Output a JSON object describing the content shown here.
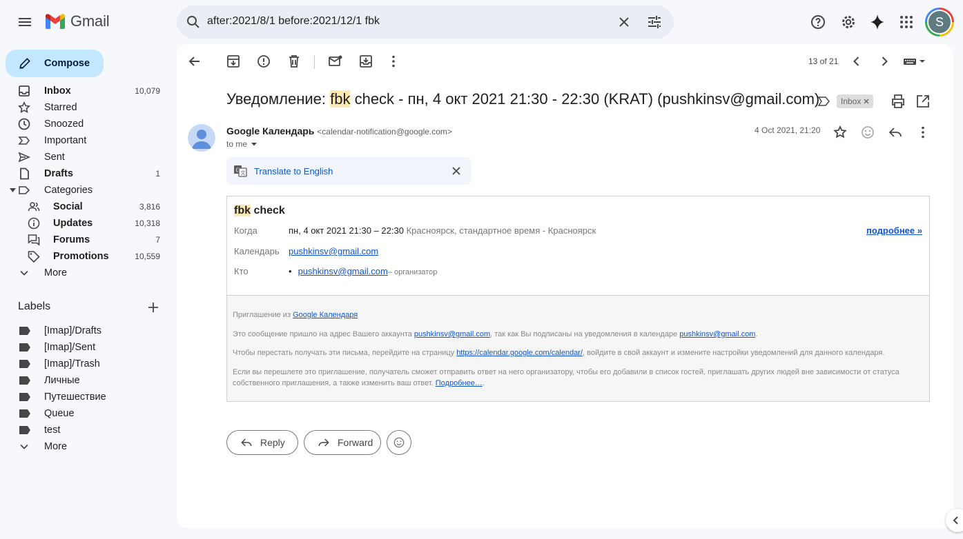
{
  "app": {
    "name": "Gmail"
  },
  "search": {
    "query": "after:2021/8/1 before:2021/12/1 fbk"
  },
  "compose": {
    "label": "Compose"
  },
  "nav": [
    {
      "label": "Inbox",
      "count": "10,079",
      "icon": "inbox-icon",
      "bold": true
    },
    {
      "label": "Starred",
      "count": "",
      "icon": "star-icon",
      "bold": false
    },
    {
      "label": "Snoozed",
      "count": "",
      "icon": "clock-icon",
      "bold": false
    },
    {
      "label": "Important",
      "count": "",
      "icon": "important-icon",
      "bold": false
    },
    {
      "label": "Sent",
      "count": "",
      "icon": "send-icon",
      "bold": false
    },
    {
      "label": "Drafts",
      "count": "1",
      "icon": "draft-icon",
      "bold": true
    },
    {
      "label": "Categories",
      "count": "",
      "icon": "label-icon",
      "bold": false
    }
  ],
  "categories": [
    {
      "label": "Social",
      "count": "3,816",
      "icon": "people-icon"
    },
    {
      "label": "Updates",
      "count": "10,318",
      "icon": "info-icon"
    },
    {
      "label": "Forums",
      "count": "7",
      "icon": "forum-icon"
    },
    {
      "label": "Promotions",
      "count": "10,559",
      "icon": "tag-icon"
    }
  ],
  "nav_more": "More",
  "labels": {
    "title": "Labels",
    "items": [
      "[Imap]/Drafts",
      "[Imap]/Sent",
      "[Imap]/Trash",
      "Личные",
      "Путешествие",
      "Queue",
      "test"
    ],
    "more": "More"
  },
  "toolbar": {
    "pager": "13 of 21"
  },
  "email": {
    "subject_prefix": "Уведомление: ",
    "subject_highlight": "fbk",
    "subject_rest": " check - пн, 4 окт 2021 21:30 - 22:30 (KRAT) (pushkinsv@gmail.com)",
    "inbox_chip": "Inbox",
    "sender_name": "Google Календарь",
    "sender_email": "<calendar-notification@google.com>",
    "to": "to me",
    "date": "4 Oct 2021, 21:20",
    "translate": "Translate to English"
  },
  "invite": {
    "title_highlight": "fbk",
    "title_rest": " check",
    "when_label": "Когда",
    "when_time": "пн, 4 окт 2021 21:30 – 22:30",
    "when_tz": " Красноярск, стандартное время - Красноярск",
    "more_details": "подробнее »",
    "calendar_label": "Календарь",
    "calendar_value": "pushkinsv@gmail.com",
    "who_label": "Кто",
    "who_value": "pushkinsv@gmail.com",
    "who_role": "– организатор"
  },
  "footer": {
    "p1_text": "Приглашение из ",
    "p1_link": "Google Календаря",
    "p2_a": "Это сообщение пришло на адрес Вашего аккаунта ",
    "p2_link1": "pushkinsv@gmail.com",
    "p2_b": ", так как Вы подписаны на уведомления в календаре ",
    "p2_link2": "pushkinsv@gmail.com",
    "p2_c": ".",
    "p3_a": "Чтобы перестать получать эти письма, перейдите на страницу ",
    "p3_link": "https://calendar.google.com/calendar/",
    "p3_b": ", войдите в свой аккаунт и измените настройки уведомлений для данного календаря.",
    "p4_a": "Если вы перешлете это приглашение, получатель сможет отправить ответ на него организатору, чтобы его добавили в список гостей, приглашать других людей вне зависимости от статуса собственного приглашения, а также изменить ваш ответ. ",
    "p4_link": "Подробнее…",
    "p4_b": "."
  },
  "actions": {
    "reply": "Reply",
    "forward": "Forward"
  },
  "account": {
    "initial": "S"
  }
}
